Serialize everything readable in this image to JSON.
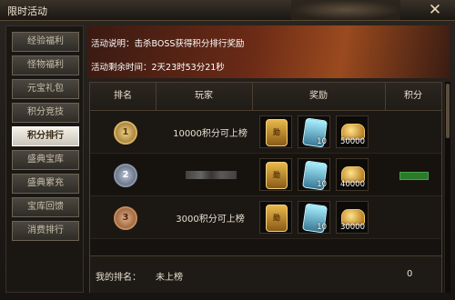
{
  "window": {
    "title": "限时活动",
    "close_label": "✕"
  },
  "sidebar": {
    "items": [
      {
        "label": "经验福利",
        "active": false
      },
      {
        "label": "怪物福利",
        "active": false
      },
      {
        "label": "元宝礼包",
        "active": false
      },
      {
        "label": "积分竞技",
        "active": false
      },
      {
        "label": "积分排行",
        "active": true
      },
      {
        "label": "盛典宝库",
        "active": false
      },
      {
        "label": "盛典累充",
        "active": false
      },
      {
        "label": "宝库回馈",
        "active": false
      },
      {
        "label": "消费排行",
        "active": false
      }
    ]
  },
  "banner": {
    "description": "活动说明：击杀BOSS获得积分排行奖励",
    "time": "活动剩余时间：2天23时53分21秒"
  },
  "table": {
    "headers": [
      "排名",
      "玩家",
      "奖励",
      "积分"
    ],
    "rows": [
      {
        "rank": "1",
        "player": "10000积分可上榜",
        "items": [
          {
            "icon": "medal-item",
            "label": "勋",
            "qty": ""
          },
          {
            "icon": "gem-item",
            "qty": "10"
          },
          {
            "icon": "gold-ingot",
            "qty": "50000"
          }
        ],
        "score": ""
      },
      {
        "rank": "2",
        "player": "",
        "items": [
          {
            "icon": "medal-item",
            "label": "勋",
            "qty": ""
          },
          {
            "icon": "gem-item",
            "qty": "10"
          },
          {
            "icon": "gold-ingot",
            "qty": "40000"
          }
        ],
        "score": ""
      },
      {
        "rank": "3",
        "player": "3000积分可上榜",
        "items": [
          {
            "icon": "medal-item",
            "label": "勋",
            "qty": ""
          },
          {
            "icon": "gem-item",
            "qty": "10"
          },
          {
            "icon": "gold-ingot",
            "qty": "30000"
          }
        ],
        "score": ""
      }
    ],
    "my_rank": {
      "label": "我的排名：",
      "value": "未上榜",
      "score": "0"
    }
  }
}
